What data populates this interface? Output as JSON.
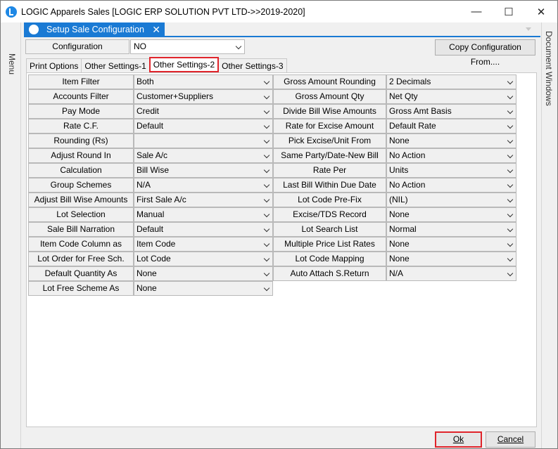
{
  "window": {
    "title": "LOGIC Apparels Sales  [LOGIC ERP SOLUTION PVT LTD->>2019-2020]",
    "minimize": "—",
    "maximize": "☐",
    "close": "✕"
  },
  "side": {
    "left_label": "Menu",
    "right_label": "Document Windows"
  },
  "doc_tab": {
    "label": "Setup Sale Configuration",
    "close": "✕"
  },
  "configuration": {
    "label": "Configuration",
    "value": "NO"
  },
  "copy_button": "Copy Configuration From....",
  "tabs": [
    {
      "label": "Print Options",
      "active": false
    },
    {
      "label": "Other Settings-1",
      "active": false
    },
    {
      "label": "Other Settings-2",
      "active": true
    },
    {
      "label": "Other Settings-3",
      "active": false
    }
  ],
  "left_fields": [
    {
      "label": "Item Filter",
      "value": "Both"
    },
    {
      "label": "Accounts Filter",
      "value": "Customer+Suppliers"
    },
    {
      "label": "Pay Mode",
      "value": "Credit"
    },
    {
      "label": "Rate C.F.",
      "value": "Default"
    },
    {
      "label": "Rounding  (Rs)",
      "value": ""
    },
    {
      "label": "Adjust Round In",
      "value": "Sale A/c"
    },
    {
      "label": "Calculation",
      "value": "Bill Wise"
    },
    {
      "label": "Group Schemes",
      "value": "N/A"
    },
    {
      "label": "Adjust Bill Wise Amounts",
      "value": "First Sale A/c"
    },
    {
      "label": "Lot Selection",
      "value": "Manual"
    },
    {
      "label": "Sale Bill Narration",
      "value": "Default"
    },
    {
      "label": "Item Code Column as",
      "value": "Item Code"
    },
    {
      "label": "Lot Order for Free Sch.",
      "value": "Lot Code"
    },
    {
      "label": "Default Quantity As",
      "value": "None"
    },
    {
      "label": "Lot Free Scheme As",
      "value": "None"
    }
  ],
  "right_fields": [
    {
      "label": "Gross Amount Rounding",
      "value": "2 Decimals"
    },
    {
      "label": "Gross Amount Qty",
      "value": "Net Qty"
    },
    {
      "label": "Divide Bill Wise Amounts",
      "value": "Gross Amt Basis"
    },
    {
      "label": "Rate for Excise Amount",
      "value": "Default Rate"
    },
    {
      "label": "Pick Excise/Unit From",
      "value": "None"
    },
    {
      "label": "Same Party/Date-New Bill",
      "value": "No Action"
    },
    {
      "label": "Rate Per",
      "value": "Units"
    },
    {
      "label": "Last Bill Within Due Date",
      "value": "No Action"
    },
    {
      "label": "Lot Code Pre-Fix",
      "value": "(NIL)"
    },
    {
      "label": "Excise/TDS Record",
      "value": "None"
    },
    {
      "label": "Lot Search List",
      "value": "Normal"
    },
    {
      "label": "Multiple Price List Rates",
      "value": "None"
    },
    {
      "label": "Lot Code Mapping",
      "value": "None"
    },
    {
      "label": "Auto Attach S.Return",
      "value": "N/A"
    }
  ],
  "buttons": {
    "ok": "Ok",
    "cancel": "Cancel"
  }
}
